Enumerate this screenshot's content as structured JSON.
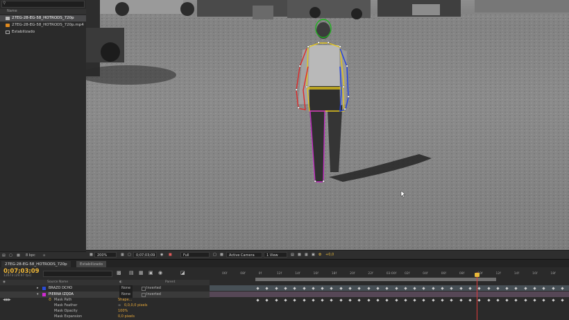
{
  "project": {
    "search_placeholder": "",
    "header": "Name",
    "items": [
      {
        "label": "27EG-28-EG-58_HOTRODS_720p",
        "selected": true,
        "icon": "composition-icon"
      },
      {
        "label": "27EG-28-EG-58_HOTRODS_720p.mp4",
        "selected": false,
        "icon": "video-file-icon"
      },
      {
        "label": "Estabilizado",
        "selected": false,
        "icon": "folder-icon"
      }
    ],
    "footer_bpc": "8 bpc"
  },
  "viewer_bar": {
    "zoom": "200%",
    "timecode": "0;07;03;09",
    "resolution": "Full",
    "camera": "Active Camera",
    "views": "1 View",
    "exposure": "+0,0"
  },
  "timeline": {
    "tabs": [
      "27EG-28-EG-58_HOTRODS_720p",
      "Estabilizado"
    ],
    "timecode": "0;07;03;09",
    "timecode_sub": "12673 (29.97 fps)",
    "col_source": "Source Name",
    "col_parent": "Parent",
    "layers": [
      {
        "num": "5",
        "name": "BRAZO DCHO",
        "mode": "None",
        "inverted": "Inverted",
        "color": "#2a4bd6"
      },
      {
        "num": "6",
        "name": "PIERNA IZQDA",
        "mode": "None",
        "inverted": "Inverted",
        "color": "#d02ad0"
      }
    ],
    "properties": [
      {
        "name": "Mask Path",
        "value": "Shape..."
      },
      {
        "name": "Mask Feather",
        "value": "0,0,0,0 pixels"
      },
      {
        "name": "Mask Opacity",
        "value": "100%"
      },
      {
        "name": "Mask Expansion",
        "value": "0,0 pixels"
      }
    ],
    "ruler": [
      "06f",
      "08f",
      "0f",
      "12f",
      "14f",
      "16f",
      "18f",
      "20f",
      "22f",
      "03:00f",
      "02f",
      "04f",
      "06f",
      "08f",
      "10f",
      "12f",
      "14f",
      "16f",
      "18f"
    ]
  },
  "colors": {
    "accent": "#f0b838",
    "head": "#1fb31f",
    "torso": "#e6c81e",
    "right_arm": "#1f3fe0",
    "left_arm": "#e02828",
    "leg": "#c02bc0"
  }
}
